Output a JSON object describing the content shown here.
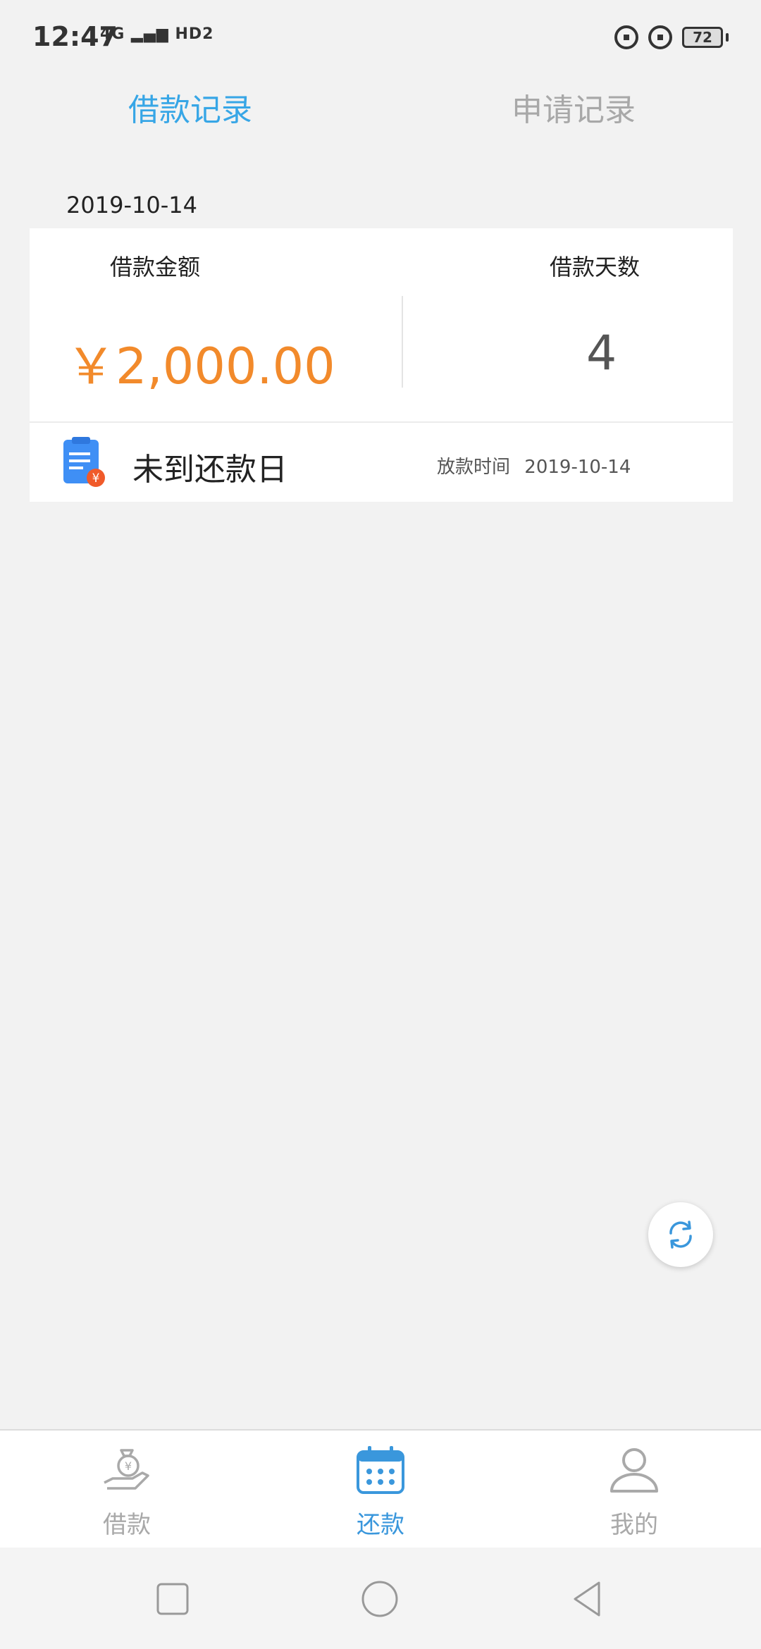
{
  "status_bar": {
    "time": "12:47",
    "network": "4G",
    "hd": "HD2",
    "battery": "72"
  },
  "tabs": [
    {
      "label": "借款记录",
      "active": true
    },
    {
      "label": "申请记录",
      "active": false
    }
  ],
  "record": {
    "date": "2019-10-14",
    "amount_label": "借款金额",
    "days_label": "借款天数",
    "amount": "￥2,000.00",
    "days": "4",
    "status": "未到还款日",
    "release_label": "放款时间",
    "release_date": "2019-10-14"
  },
  "bottom_nav": [
    {
      "label": "借款",
      "icon": "loan-bag-icon",
      "active": false
    },
    {
      "label": "还款",
      "icon": "calendar-icon",
      "active": true
    },
    {
      "label": "我的",
      "icon": "person-icon",
      "active": false
    }
  ],
  "colors": {
    "accent": "#37a6e6",
    "amount": "#f28a2b",
    "inactive": "#a9a9a9"
  }
}
